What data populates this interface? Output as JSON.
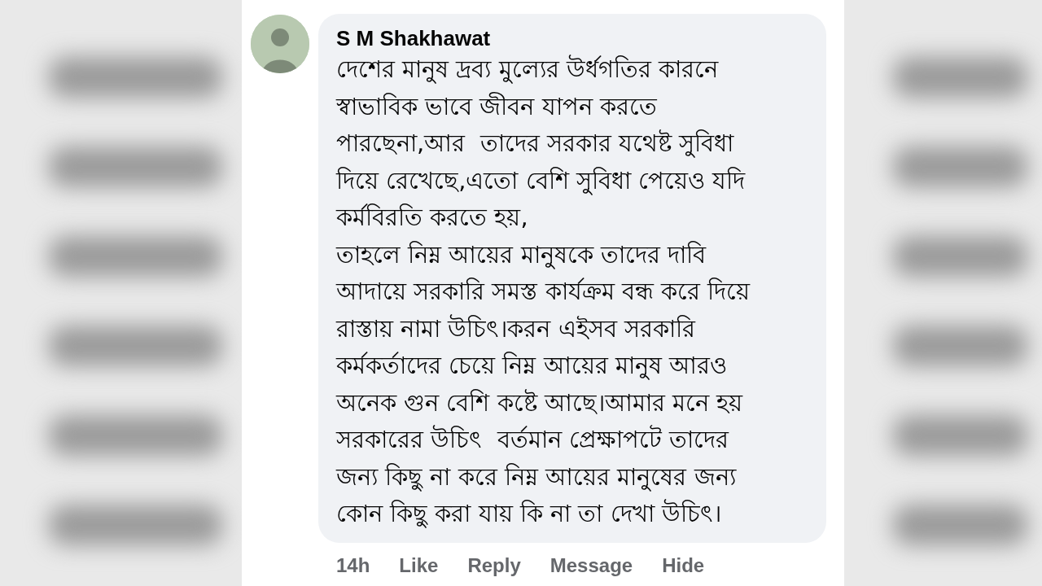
{
  "comment": {
    "author": "S M Shakhawat",
    "text": "দেশের মানুষ দ্রব্য মুল্যের উর্ধগতির কারনে\nস্বাভাবিক ভাবে জীবন যাপন করতে\nপারছেনা,আর  তাদের সরকার যথেষ্ট সুবিধা\nদিয়ে রেখেছে,এতো বেশি সুবিধা পেয়েও যদি\nকর্মবিরতি করতে হয়,\nতাহলে নিম্ন আয়ের মানুষকে তাদের দাবি\nআদায়ে সরকারি সমস্ত কার্যক্রম বন্ধ করে দিয়ে\nরাস্তায় নামা উচিৎ।করন এইসব সরকারি\nকর্মকর্তাদের চেয়ে নিম্ন আয়ের মানুষ আরও\nঅনেক গুন বেশি কষ্টে আছে।আমার মনে হয়\nসরকারের উচিৎ  বর্তমান প্রেক্ষাপটে তাদের\nজন্য কিছু না করে নিম্ন আয়ের মানুষের জন্য\nকোন কিছু করা যায় কি না তা দেখা উচিৎ।",
    "time": "14h",
    "actions": [
      "Like",
      "Reply",
      "Message",
      "Hide"
    ]
  }
}
